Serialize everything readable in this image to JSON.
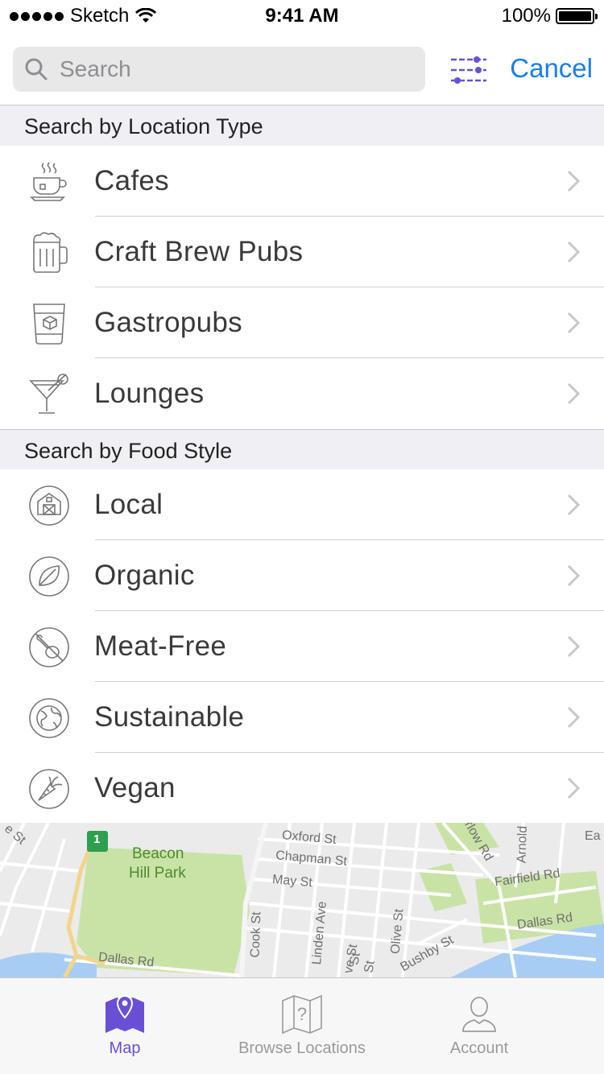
{
  "status_bar": {
    "carrier": "Sketch",
    "time": "9:41 AM",
    "battery": "100%"
  },
  "search": {
    "placeholder": "Search",
    "value": "",
    "cancel_label": "Cancel"
  },
  "sections": [
    {
      "title": "Search by Location Type",
      "items": [
        {
          "label": "Cafes",
          "icon": "coffee-cup-icon"
        },
        {
          "label": "Craft Brew Pubs",
          "icon": "beer-mug-icon"
        },
        {
          "label": "Gastropubs",
          "icon": "rocks-glass-icon"
        },
        {
          "label": "Lounges",
          "icon": "cocktail-glass-icon"
        }
      ]
    },
    {
      "title": "Search by Food Style",
      "items": [
        {
          "label": "Local",
          "icon": "barn-icon"
        },
        {
          "label": "Organic",
          "icon": "leaf-icon"
        },
        {
          "label": "Meat-Free",
          "icon": "no-meat-icon"
        },
        {
          "label": "Sustainable",
          "icon": "globe-icon"
        },
        {
          "label": "Vegan",
          "icon": "carrot-icon"
        }
      ]
    }
  ],
  "map": {
    "labels": [
      "Oxford St",
      "Chapman St",
      "May St",
      "Beacon",
      "Hill Park",
      "Cook St",
      "Linden Ave",
      "Olive St",
      "Bushby St",
      "Fairfield Rd",
      "Dallas Rd",
      "Dallas Rd",
      "Arnold",
      "urlow Rd",
      "Ea",
      "e St",
      "St",
      "St",
      "ve St"
    ],
    "highway_badge": "1"
  },
  "tab_bar": {
    "tabs": [
      {
        "label": "Map",
        "icon": "map-pin-icon",
        "active": true
      },
      {
        "label": "Browse Locations",
        "icon": "map-question-icon",
        "active": false
      },
      {
        "label": "Account",
        "icon": "user-icon",
        "active": false
      }
    ]
  },
  "colors": {
    "accent": "#6a4fd6",
    "link": "#1a7ee8",
    "section_bg": "#efeff4",
    "park": "#c9e3a6",
    "water": "#a8cdf4"
  }
}
